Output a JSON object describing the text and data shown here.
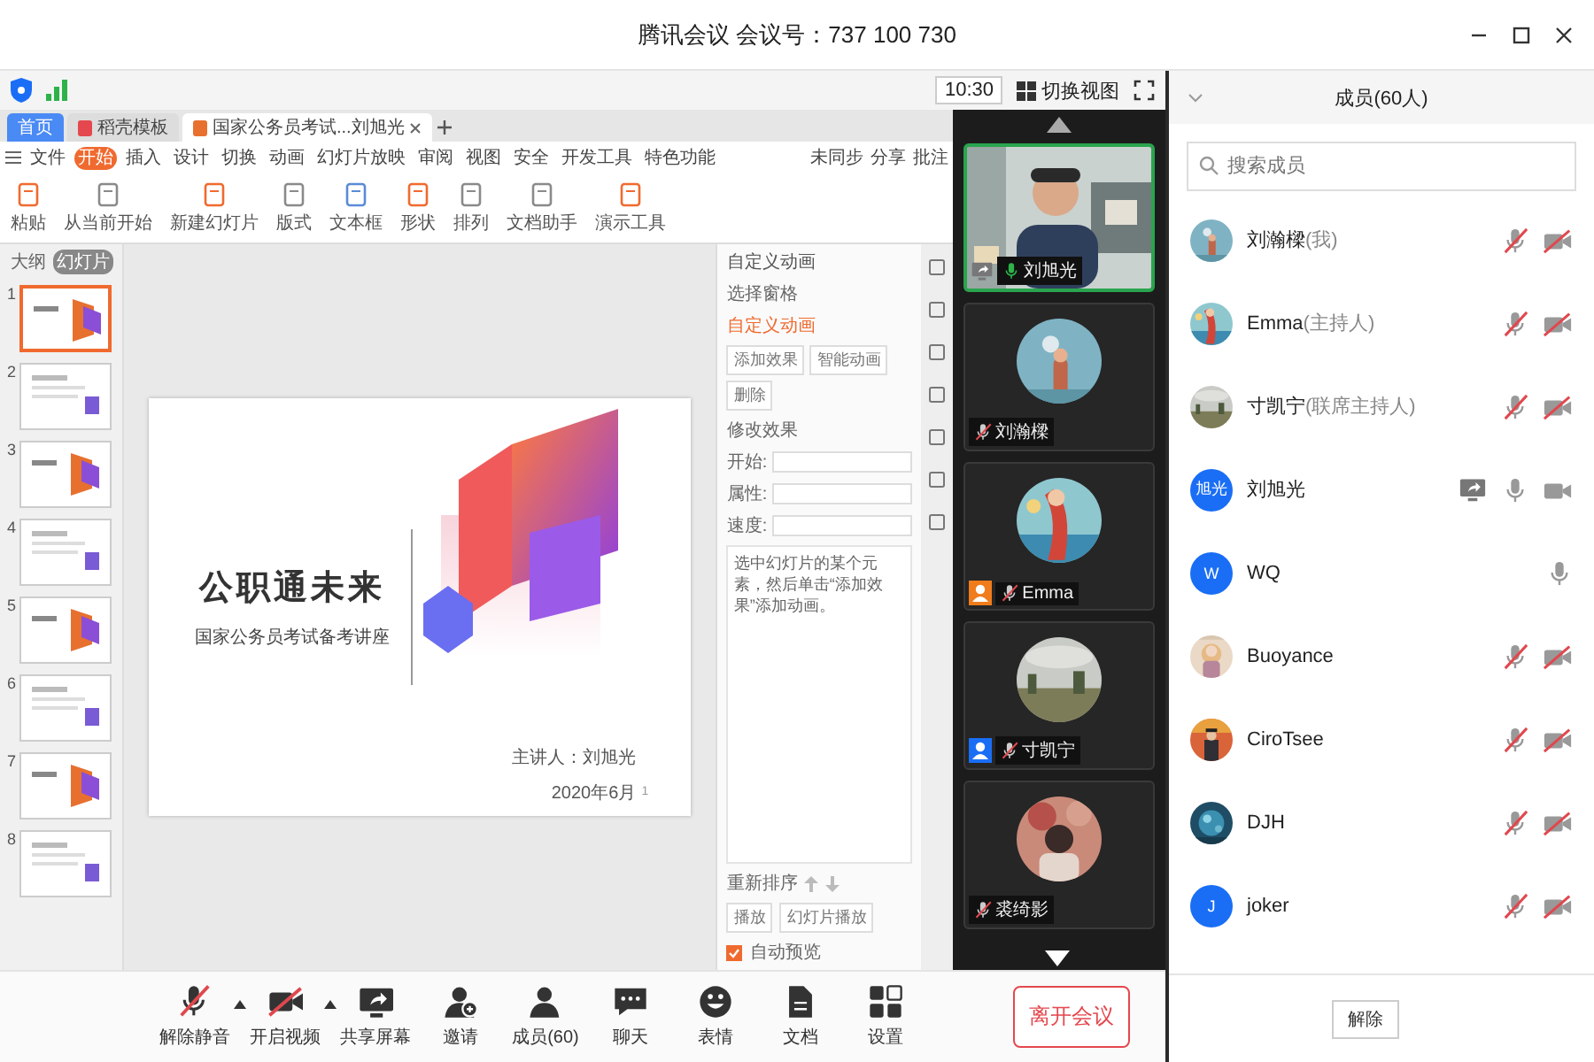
{
  "window": {
    "title": "腾讯会议 会议号：737 100 730"
  },
  "topbar": {
    "time": "10:30",
    "view_button": "切换视图"
  },
  "shared_screen": {
    "tabs": [
      {
        "label": "首页",
        "kind": "home",
        "selected": false
      },
      {
        "label": "稻壳模板",
        "kind": "doc",
        "selected": false
      },
      {
        "label": "国家公务员考试...刘旭光",
        "kind": "ppt",
        "selected": true
      }
    ],
    "menu": [
      {
        "label": "文件",
        "selected": false
      },
      {
        "label": "开始",
        "selected": true
      },
      {
        "label": "插入",
        "selected": false
      },
      {
        "label": "设计",
        "selected": false
      },
      {
        "label": "切换",
        "selected": false
      },
      {
        "label": "动画",
        "selected": false
      },
      {
        "label": "幻灯片放映",
        "selected": false
      },
      {
        "label": "审阅",
        "selected": false
      },
      {
        "label": "视图",
        "selected": false
      },
      {
        "label": "安全",
        "selected": false
      },
      {
        "label": "开发工具",
        "selected": false
      },
      {
        "label": "特色功能",
        "selected": false
      }
    ],
    "menu_right": [
      "未同步",
      "分享",
      "批注"
    ],
    "ribbon": [
      "粘贴",
      "从当前开始",
      "新建幻灯片",
      "版式",
      "文本框",
      "形状",
      "排列",
      "文档助手",
      "演示工具"
    ],
    "panel_tabs": [
      {
        "label": "大纲",
        "selected": false
      },
      {
        "label": "幻灯片",
        "selected": true
      }
    ],
    "thumbnails": [
      {
        "number": "1",
        "selected": true
      },
      {
        "number": "2",
        "selected": false
      },
      {
        "number": "3",
        "selected": false
      },
      {
        "number": "4",
        "selected": false
      },
      {
        "number": "5",
        "selected": false
      },
      {
        "number": "6",
        "selected": false
      },
      {
        "number": "7",
        "selected": false
      },
      {
        "number": "8",
        "selected": false
      }
    ],
    "slide": {
      "title": "公职通未来",
      "subtitle": "国家公务员考试备考讲座",
      "presenter": "主讲人：刘旭光",
      "date": "2020年6月",
      "page": "1"
    },
    "animation_pane": {
      "title": "自定义动画",
      "selection_pane": "选择窗格",
      "section": "自定义动画",
      "buttons": [
        "添加效果",
        "智能动画",
        "删除"
      ],
      "modify": "修改效果",
      "fields": [
        "开始:",
        "属性:",
        "速度:"
      ],
      "hint": "选中幻灯片的某个元素，然后单击“添加效果”添加动画。",
      "reorder": "重新排序",
      "play_buttons": [
        "播放",
        "幻灯片播放"
      ],
      "autopreview": {
        "label": "自动预览",
        "checked": true
      }
    }
  },
  "video_tiles": [
    {
      "name": "刘旭光",
      "kind": "video",
      "speaking": true,
      "muted": false,
      "sharing": true
    },
    {
      "name": "刘瀚樑",
      "kind": "avatar",
      "speaking": false,
      "muted": true,
      "sharing": false
    },
    {
      "name": "Emma",
      "kind": "avatar",
      "speaking": false,
      "muted": true,
      "color": "#f07c1c",
      "sharing": false
    },
    {
      "name": "寸凯宁",
      "kind": "avatar",
      "speaking": false,
      "muted": true,
      "color": "#1a6ef5",
      "sharing": false
    },
    {
      "name": "裘绮影",
      "kind": "avatar",
      "speaking": false,
      "muted": true,
      "sharing": false
    }
  ],
  "members": {
    "title": "成员(60人)",
    "search_placeholder": "搜索成员",
    "items": [
      {
        "name": "刘瀚樑",
        "role": "(我)",
        "muted": true,
        "video_on": false,
        "sharing": false
      },
      {
        "name": "Emma",
        "role": "(主持人)",
        "muted": true,
        "video_on": false,
        "sharing": false
      },
      {
        "name": "寸凯宁",
        "role": "(联席主持人)",
        "muted": true,
        "video_on": false,
        "sharing": false
      },
      {
        "name": "刘旭光",
        "avatar": {
          "kind": "letter",
          "text": "旭光"
        },
        "muted": false,
        "video_on": true,
        "sharing": true
      },
      {
        "name": "WQ",
        "avatar": {
          "kind": "letter",
          "text": "W"
        },
        "muted": false,
        "sharing": false
      },
      {
        "name": "Buoyance",
        "muted": true,
        "video_on": false,
        "sharing": false
      },
      {
        "name": "CiroTsee",
        "muted": true,
        "video_on": false,
        "sharing": false
      },
      {
        "name": "DJH",
        "muted": true,
        "video_on": false,
        "sharing": false
      },
      {
        "name": "joker",
        "avatar": {
          "kind": "letter",
          "text": "J"
        },
        "muted": true,
        "video_on": false,
        "sharing": false
      }
    ],
    "footer_button": "解除"
  },
  "toolbar": {
    "items": [
      {
        "label": "解除静音",
        "kind": "mic",
        "off": true,
        "caret": true
      },
      {
        "label": "开启视频",
        "kind": "camera",
        "off": true,
        "caret": true
      },
      {
        "label": "共享屏幕",
        "kind": "share"
      },
      {
        "label": "邀请",
        "kind": "invite"
      },
      {
        "label": "成员(60)",
        "kind": "members"
      },
      {
        "label": "聊天",
        "kind": "chat"
      },
      {
        "label": "表情",
        "kind": "emoji"
      },
      {
        "label": "文档",
        "kind": "docs"
      },
      {
        "label": "设置",
        "kind": "settings"
      }
    ],
    "leave": "离开会议"
  }
}
